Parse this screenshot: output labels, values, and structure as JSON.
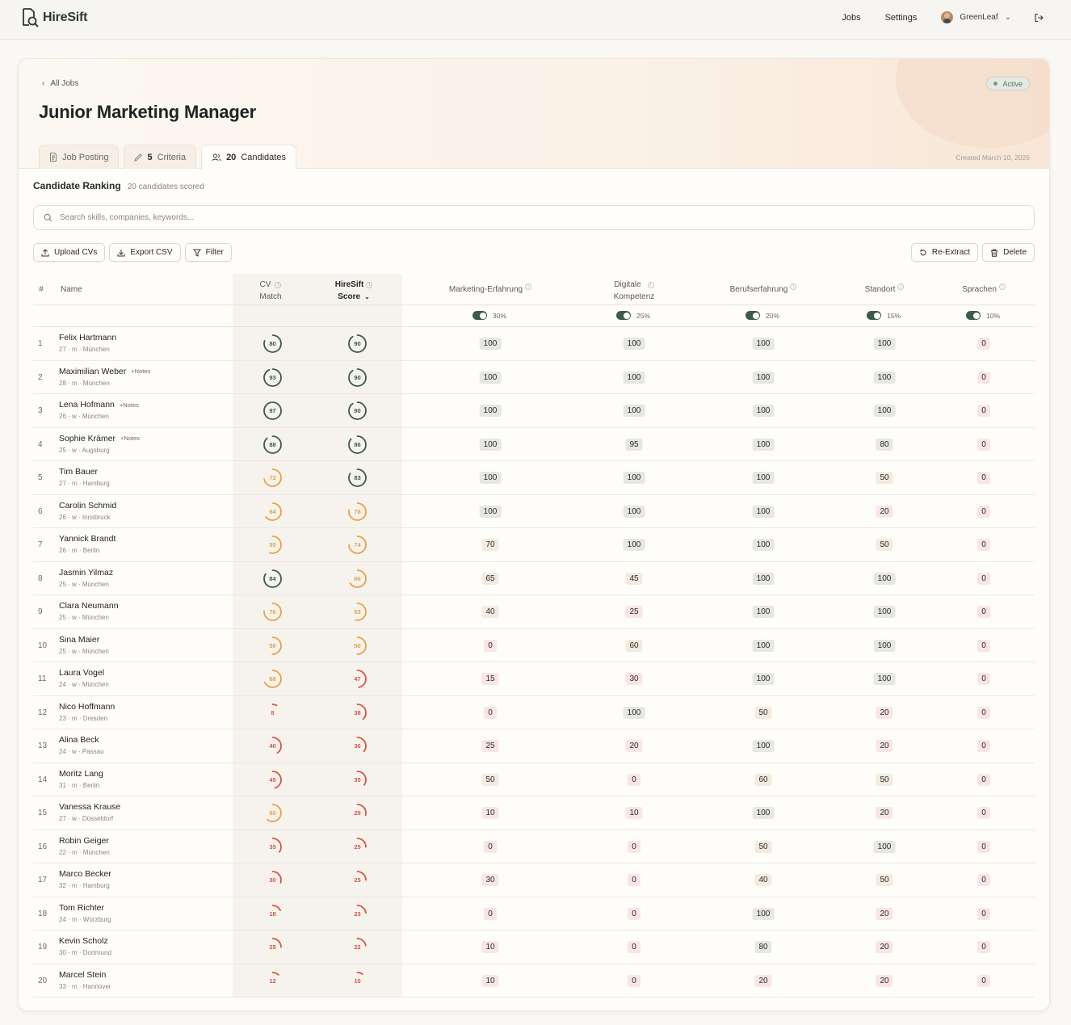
{
  "app": {
    "name": "HireSift"
  },
  "nav": {
    "jobs": "Jobs",
    "settings": "Settings",
    "user": "GreenLeaf"
  },
  "job": {
    "back_label": "All Jobs",
    "title": "Junior Marketing Manager",
    "status": "Active",
    "created": "Created March 10, 2026",
    "tabs": [
      {
        "label": "Job Posting",
        "count": ""
      },
      {
        "label": "Criteria",
        "count": "5"
      },
      {
        "label": "Candidates",
        "count": "20"
      }
    ]
  },
  "ranking": {
    "title": "Candidate Ranking",
    "subtitle": "20 candidates scored"
  },
  "search": {
    "placeholder": "Search skills, companies, keywords..."
  },
  "toolbar": {
    "upload": "Upload CVs",
    "export": "Export CSV",
    "filter": "Filter",
    "reextract": "Re-Extract",
    "delete": "Delete"
  },
  "columns": {
    "num": "#",
    "name": "Name",
    "cv_match_1": "CV",
    "cv_match_2": "Match",
    "score_1": "HireSift",
    "score_2": "Score"
  },
  "criteria": [
    {
      "label": "Marketing-Erfahrung",
      "label2": "",
      "weight": "30%"
    },
    {
      "label": "Digitale",
      "label2": "Kompetenz",
      "weight": "25%"
    },
    {
      "label": "Berufserfahrung",
      "label2": "",
      "weight": "20%"
    },
    {
      "label": "Standort",
      "label2": "",
      "weight": "15%"
    },
    {
      "label": "Sprachen",
      "label2": "",
      "weight": "10%"
    }
  ],
  "colors": {
    "high": "#3d5a4c",
    "mid": "#e8a144",
    "low": "#d9533f"
  },
  "candidates": [
    {
      "n": "1",
      "name": "Felix Hartmann",
      "notes": "",
      "meta": "27 · m · München",
      "cv": 80,
      "score": 90,
      "c": [
        100,
        100,
        100,
        100,
        0
      ]
    },
    {
      "n": "2",
      "name": "Maximilian Weber",
      "notes": "+Notes",
      "meta": "28 · m · München",
      "cv": 93,
      "score": 90,
      "c": [
        100,
        100,
        100,
        100,
        0
      ]
    },
    {
      "n": "3",
      "name": "Lena Hofmann",
      "notes": "+Notes",
      "meta": "26 · w · München",
      "cv": 97,
      "score": 90,
      "c": [
        100,
        100,
        100,
        100,
        0
      ]
    },
    {
      "n": "4",
      "name": "Sophie Krämer",
      "notes": "+Notes",
      "meta": "25 · w · Augsburg",
      "cv": 88,
      "score": 86,
      "c": [
        100,
        95,
        100,
        80,
        0
      ]
    },
    {
      "n": "5",
      "name": "Tim Bauer",
      "notes": "",
      "meta": "27 · m · Hamburg",
      "cv": 72,
      "score": 83,
      "c": [
        100,
        100,
        100,
        50,
        0
      ]
    },
    {
      "n": "6",
      "name": "Carolin Schmid",
      "notes": "",
      "meta": "26 · w · Innsbruck",
      "cv": 64,
      "score": 78,
      "c": [
        100,
        100,
        100,
        20,
        0
      ]
    },
    {
      "n": "7",
      "name": "Yannick Brandt",
      "notes": "",
      "meta": "26 · m · Berlin",
      "cv": 55,
      "score": 74,
      "c": [
        70,
        100,
        100,
        50,
        0
      ]
    },
    {
      "n": "8",
      "name": "Jasmin Yilmaz",
      "notes": "",
      "meta": "25 · w · München",
      "cv": 84,
      "score": 66,
      "c": [
        65,
        45,
        100,
        100,
        0
      ]
    },
    {
      "n": "9",
      "name": "Clara Neumann",
      "notes": "",
      "meta": "25 · w · München",
      "cv": 76,
      "score": 53,
      "c": [
        40,
        25,
        100,
        100,
        0
      ]
    },
    {
      "n": "10",
      "name": "Sina Maier",
      "notes": "",
      "meta": "25 · w · München",
      "cv": 50,
      "score": 50,
      "c": [
        0,
        60,
        100,
        100,
        0
      ]
    },
    {
      "n": "11",
      "name": "Laura Vogel",
      "notes": "",
      "meta": "24 · w · München",
      "cv": 68,
      "score": 47,
      "c": [
        15,
        30,
        100,
        100,
        0
      ]
    },
    {
      "n": "12",
      "name": "Nico Hoffmann",
      "notes": "",
      "meta": "23 · m · Dresden",
      "cv": 8,
      "score": 38,
      "c": [
        0,
        100,
        50,
        20,
        0
      ]
    },
    {
      "n": "13",
      "name": "Alina Beck",
      "notes": "",
      "meta": "24 · w · Passau",
      "cv": 40,
      "score": 36,
      "c": [
        25,
        20,
        100,
        20,
        0
      ]
    },
    {
      "n": "14",
      "name": "Moritz Lang",
      "notes": "",
      "meta": "31 · m · Berlin",
      "cv": 45,
      "score": 35,
      "c": [
        50,
        0,
        60,
        50,
        0
      ]
    },
    {
      "n": "15",
      "name": "Vanessa Krause",
      "notes": "",
      "meta": "27 · w · Düsseldorf",
      "cv": 60,
      "score": 29,
      "c": [
        10,
        10,
        100,
        20,
        0
      ]
    },
    {
      "n": "16",
      "name": "Robin Geiger",
      "notes": "",
      "meta": "22 · m · München",
      "cv": 35,
      "score": 25,
      "c": [
        0,
        0,
        50,
        100,
        0
      ]
    },
    {
      "n": "17",
      "name": "Marco Becker",
      "notes": "",
      "meta": "32 · m · Hamburg",
      "cv": 30,
      "score": 25,
      "c": [
        30,
        0,
        40,
        50,
        0
      ]
    },
    {
      "n": "18",
      "name": "Tom Richter",
      "notes": "",
      "meta": "24 · m · Würzburg",
      "cv": 18,
      "score": 23,
      "c": [
        0,
        0,
        100,
        20,
        0
      ]
    },
    {
      "n": "19",
      "name": "Kevin Scholz",
      "notes": "",
      "meta": "30 · m · Dortmund",
      "cv": 25,
      "score": 22,
      "c": [
        10,
        0,
        80,
        20,
        0
      ]
    },
    {
      "n": "20",
      "name": "Marcel Stein",
      "notes": "",
      "meta": "33 · m · Hannover",
      "cv": 12,
      "score": 10,
      "c": [
        10,
        0,
        20,
        20,
        0
      ]
    }
  ]
}
